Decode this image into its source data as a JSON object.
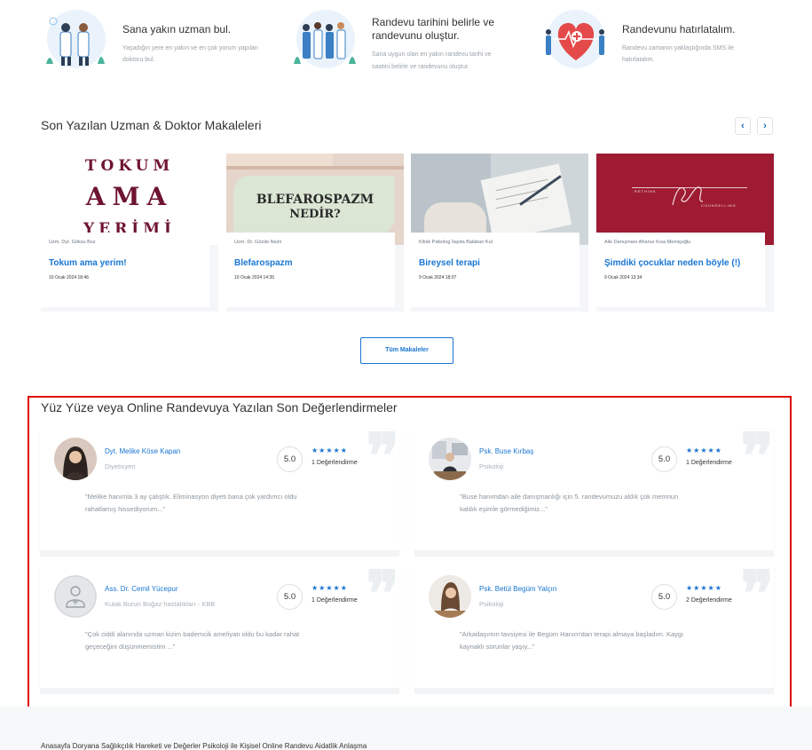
{
  "features": [
    {
      "title": "Sana yakın uzman bul.",
      "desc_lines": [
        "Yaşadığın yere en yakın ve en çok yorum yapılan",
        "doktoru bul."
      ]
    },
    {
      "title_lines": [
        "Randevu tarihini belirle ve",
        "randevunu oluştur."
      ],
      "desc_lines": [
        "Sana uygun olan en yakın randevu tarihi ve",
        "saatini belirle ve randevunu oluştur."
      ]
    },
    {
      "title": "Randevunu hatırlatalım.",
      "desc_lines": [
        "Randevu zamanın yaklaştığında SMS ile",
        "hatırlatalım."
      ]
    }
  ],
  "articles_section": {
    "title": "Son Yazılan Uzman & Doktor Makaleleri",
    "prev": "‹",
    "next": "›",
    "all_button": "Tüm Makaleler"
  },
  "articles": [
    {
      "image_text": [
        "TOKUM",
        "AMA",
        "YERİMİ"
      ],
      "author": "Uzm. Dyt. Göksu Boz",
      "title": "Tokum ama yerim!",
      "date": "10 Ocak 2024 18:46"
    },
    {
      "image_text": [
        "BLEFAROSPAZM",
        "NEDİR?"
      ],
      "author": "Uzm. Dr. Gözde Nezir",
      "title": "Blefarospazm",
      "date": "10 Ocak 2024 14:35"
    },
    {
      "author": "Klinik Psikolog İlayda Balaban Kul",
      "title": "Bireysel terapi",
      "date": "9 Ocak 2024 18:07"
    },
    {
      "image_text": [
        "RETHINK",
        "COUNSELLING"
      ],
      "author": "Aile Danışmanı Afranur Kısa Memişoğlu",
      "title": "Şimdiki çocuklar neden böyle (!)",
      "date": "9 Ocak 2024 13:34"
    }
  ],
  "reviews_section": {
    "title": "Yüz Yüze veya Online Randevuya Yazılan Son Değerlendirmeler"
  },
  "reviews": [
    {
      "name": "Dyt. Melike Köse Kapan",
      "specialty": "Diyetisyen",
      "score": "5.0",
      "stars": "★★★★★",
      "count": "1 Değerlendirme",
      "text_lines": [
        "\"Melike hanımla 3 ay çalıştık. Eliminasyon diyeti bana çok yardımcı oldu",
        "rahatlamış hissediyorum...\""
      ]
    },
    {
      "name": "Psk. Buse Kırbaş",
      "specialty": "Psikoloji",
      "score": "5.0",
      "stars": "★★★★★",
      "count": "1 Değerlendirme",
      "text_lines": [
        "\"Buse hanımdan aile danışmanlığı için 5. randevumuzu aldık çok memnun",
        "kaldık eşimle görmediğimiz...\""
      ]
    },
    {
      "name": "Ass. Dr. Cemil Yücepur",
      "specialty": "Kulak Burun Boğaz hastalıkları - KBB",
      "score": "5.0",
      "stars": "★★★★★",
      "count": "1 Değerlendirme",
      "text_lines": [
        "\"Çok ciddi alanında uzman kizim bademcik ameliyatı oldu bu kadar rahat",
        "geçeceğini düşünmemistim ...\""
      ]
    },
    {
      "name": "Psk. Betül Begüm Yalçın",
      "specialty": "Psikoloji",
      "score": "5.0",
      "stars": "★★★★★",
      "count": "2 Değerlendirme",
      "text_lines": [
        "\"Arkadaşımın tavsiyesi ile Begüm Hanım'dan terapi almaya başladım. Kaygı",
        "kaynaklı sorunlar yaşıy...\""
      ]
    }
  ],
  "footer": {
    "links": "Anasayfa     Doryana     Sağlıkçılık Hareketi ve Değerler     Psikoloji ile Kişisel     Online Randevu     Aidatlik Anlaşma"
  },
  "colors": {
    "accent": "#1976d2",
    "highlight_border": "#e00000"
  }
}
